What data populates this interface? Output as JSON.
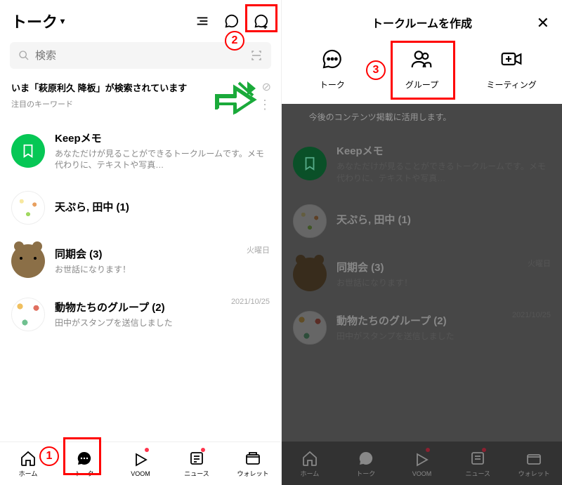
{
  "left": {
    "title": "トーク",
    "search_placeholder": "検索",
    "trend_text": "いま「萩原利久 降板」が検索されています",
    "trend_sub": "注目のキーワード",
    "chats": [
      {
        "name": "Keepメモ",
        "preview": "あなただけが見ることができるトークルームです。メモ代わりに、テキストや写真…",
        "date": ""
      },
      {
        "name": "天ぷら, 田中  (1)",
        "preview": "",
        "date": ""
      },
      {
        "name": "同期会  (3)",
        "preview": "お世話になります！",
        "date": "火曜日"
      },
      {
        "name": "動物たちのグループ  (2)",
        "preview": "田中がスタンプを送信しました",
        "date": "2021/10/25"
      }
    ],
    "tabs": [
      {
        "label": "ホーム"
      },
      {
        "label": "トーク"
      },
      {
        "label": "VOOM"
      },
      {
        "label": "ニュース"
      },
      {
        "label": "ウォレット"
      }
    ]
  },
  "right": {
    "title": "トークルームを作成",
    "options": [
      {
        "label": "トーク"
      },
      {
        "label": "グループ"
      },
      {
        "label": "ミーティング"
      }
    ],
    "dim_notice": "今後のコンテンツ掲載に活用します。"
  },
  "annotations": {
    "n1": "1",
    "n2": "2",
    "n3": "3"
  }
}
